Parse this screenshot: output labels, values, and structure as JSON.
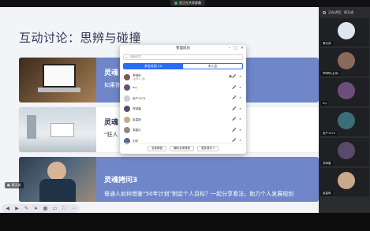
{
  "share": {
    "label": "您正在共享屏幕"
  },
  "slide": {
    "title": "互动讨论：思辨与碰撞",
    "items": [
      {
        "title": "灵魂",
        "text": "如果你                                   央策依据，引发对投资策略的"
      },
      {
        "title": "灵魂",
        "text": "“狂人                                   家探讨，为创业决策提供洞"
      },
      {
        "title": "灵魂拷问3",
        "text": "普通人如何借鉴“50年计划”制定个人目标？一起分享看法，助力个人发展规划"
      }
    ],
    "cam_label": "周天成"
  },
  "panel": {
    "header": "正在讲话：周天成",
    "tiles": [
      {
        "name": "周天成",
        "color": "#e0e6f0"
      },
      {
        "name": "李明轩(主持)",
        "color": "#8a6a5a"
      },
      {
        "name": "my",
        "color": "#6b4f7a"
      },
      {
        "name": "用户1474",
        "color": "#3c6e7a"
      },
      {
        "name": "郑泽晨",
        "color": "#5a4a6a"
      },
      {
        "name": "赵嘉琪",
        "color": "#c9a98a"
      }
    ]
  },
  "dialog": {
    "title": "管理成员",
    "search_placeholder": "搜索成员",
    "tabs": [
      "参会成员(13)",
      "未入会"
    ],
    "members": [
      {
        "name": "李明轩",
        "note": "(主持人, 我)",
        "color": "#7a5a4a"
      },
      {
        "name": "my",
        "note": "",
        "color": "#6b4f7a"
      },
      {
        "name": "用户1474",
        "note": "",
        "color": "#c8cdd6"
      },
      {
        "name": "郑泽晨",
        "note": "",
        "color": "#5a4a6a"
      },
      {
        "name": "赵嘉琪",
        "note": "",
        "color": "#c9a98a"
      },
      {
        "name": "周嘉仪",
        "note": "",
        "color": "#8a8a8a"
      },
      {
        "name": "刘洋",
        "note": "",
        "color": "#4f6a8a"
      }
    ],
    "buttons": [
      "全体静音",
      "解除全体静音",
      "更多操作 ▾"
    ]
  }
}
